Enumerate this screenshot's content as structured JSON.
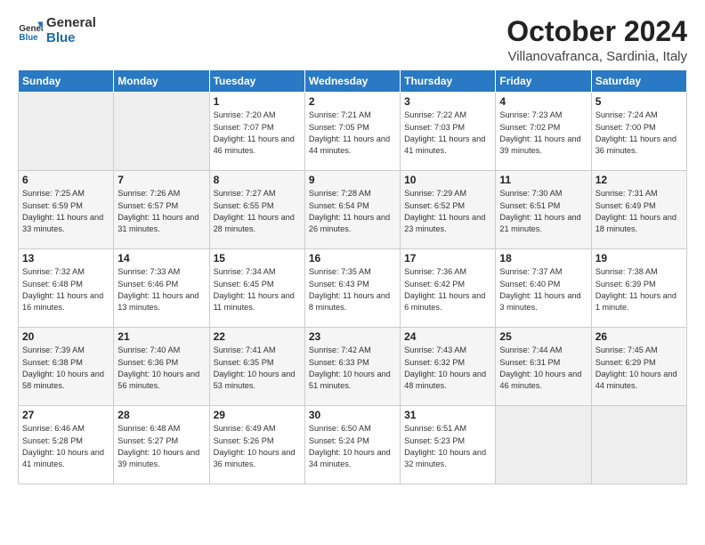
{
  "logo": {
    "general": "General",
    "blue": "Blue"
  },
  "title": "October 2024",
  "subtitle": "Villanovafranca, Sardinia, Italy",
  "headers": [
    "Sunday",
    "Monday",
    "Tuesday",
    "Wednesday",
    "Thursday",
    "Friday",
    "Saturday"
  ],
  "weeks": [
    [
      {
        "num": "",
        "info": ""
      },
      {
        "num": "",
        "info": ""
      },
      {
        "num": "1",
        "info": "Sunrise: 7:20 AM\nSunset: 7:07 PM\nDaylight: 11 hours and 46 minutes."
      },
      {
        "num": "2",
        "info": "Sunrise: 7:21 AM\nSunset: 7:05 PM\nDaylight: 11 hours and 44 minutes."
      },
      {
        "num": "3",
        "info": "Sunrise: 7:22 AM\nSunset: 7:03 PM\nDaylight: 11 hours and 41 minutes."
      },
      {
        "num": "4",
        "info": "Sunrise: 7:23 AM\nSunset: 7:02 PM\nDaylight: 11 hours and 39 minutes."
      },
      {
        "num": "5",
        "info": "Sunrise: 7:24 AM\nSunset: 7:00 PM\nDaylight: 11 hours and 36 minutes."
      }
    ],
    [
      {
        "num": "6",
        "info": "Sunrise: 7:25 AM\nSunset: 6:59 PM\nDaylight: 11 hours and 33 minutes."
      },
      {
        "num": "7",
        "info": "Sunrise: 7:26 AM\nSunset: 6:57 PM\nDaylight: 11 hours and 31 minutes."
      },
      {
        "num": "8",
        "info": "Sunrise: 7:27 AM\nSunset: 6:55 PM\nDaylight: 11 hours and 28 minutes."
      },
      {
        "num": "9",
        "info": "Sunrise: 7:28 AM\nSunset: 6:54 PM\nDaylight: 11 hours and 26 minutes."
      },
      {
        "num": "10",
        "info": "Sunrise: 7:29 AM\nSunset: 6:52 PM\nDaylight: 11 hours and 23 minutes."
      },
      {
        "num": "11",
        "info": "Sunrise: 7:30 AM\nSunset: 6:51 PM\nDaylight: 11 hours and 21 minutes."
      },
      {
        "num": "12",
        "info": "Sunrise: 7:31 AM\nSunset: 6:49 PM\nDaylight: 11 hours and 18 minutes."
      }
    ],
    [
      {
        "num": "13",
        "info": "Sunrise: 7:32 AM\nSunset: 6:48 PM\nDaylight: 11 hours and 16 minutes."
      },
      {
        "num": "14",
        "info": "Sunrise: 7:33 AM\nSunset: 6:46 PM\nDaylight: 11 hours and 13 minutes."
      },
      {
        "num": "15",
        "info": "Sunrise: 7:34 AM\nSunset: 6:45 PM\nDaylight: 11 hours and 11 minutes."
      },
      {
        "num": "16",
        "info": "Sunrise: 7:35 AM\nSunset: 6:43 PM\nDaylight: 11 hours and 8 minutes."
      },
      {
        "num": "17",
        "info": "Sunrise: 7:36 AM\nSunset: 6:42 PM\nDaylight: 11 hours and 6 minutes."
      },
      {
        "num": "18",
        "info": "Sunrise: 7:37 AM\nSunset: 6:40 PM\nDaylight: 11 hours and 3 minutes."
      },
      {
        "num": "19",
        "info": "Sunrise: 7:38 AM\nSunset: 6:39 PM\nDaylight: 11 hours and 1 minute."
      }
    ],
    [
      {
        "num": "20",
        "info": "Sunrise: 7:39 AM\nSunset: 6:38 PM\nDaylight: 10 hours and 58 minutes."
      },
      {
        "num": "21",
        "info": "Sunrise: 7:40 AM\nSunset: 6:36 PM\nDaylight: 10 hours and 56 minutes."
      },
      {
        "num": "22",
        "info": "Sunrise: 7:41 AM\nSunset: 6:35 PM\nDaylight: 10 hours and 53 minutes."
      },
      {
        "num": "23",
        "info": "Sunrise: 7:42 AM\nSunset: 6:33 PM\nDaylight: 10 hours and 51 minutes."
      },
      {
        "num": "24",
        "info": "Sunrise: 7:43 AM\nSunset: 6:32 PM\nDaylight: 10 hours and 48 minutes."
      },
      {
        "num": "25",
        "info": "Sunrise: 7:44 AM\nSunset: 6:31 PM\nDaylight: 10 hours and 46 minutes."
      },
      {
        "num": "26",
        "info": "Sunrise: 7:45 AM\nSunset: 6:29 PM\nDaylight: 10 hours and 44 minutes."
      }
    ],
    [
      {
        "num": "27",
        "info": "Sunrise: 6:46 AM\nSunset: 5:28 PM\nDaylight: 10 hours and 41 minutes."
      },
      {
        "num": "28",
        "info": "Sunrise: 6:48 AM\nSunset: 5:27 PM\nDaylight: 10 hours and 39 minutes."
      },
      {
        "num": "29",
        "info": "Sunrise: 6:49 AM\nSunset: 5:26 PM\nDaylight: 10 hours and 36 minutes."
      },
      {
        "num": "30",
        "info": "Sunrise: 6:50 AM\nSunset: 5:24 PM\nDaylight: 10 hours and 34 minutes."
      },
      {
        "num": "31",
        "info": "Sunrise: 6:51 AM\nSunset: 5:23 PM\nDaylight: 10 hours and 32 minutes."
      },
      {
        "num": "",
        "info": ""
      },
      {
        "num": "",
        "info": ""
      }
    ]
  ]
}
